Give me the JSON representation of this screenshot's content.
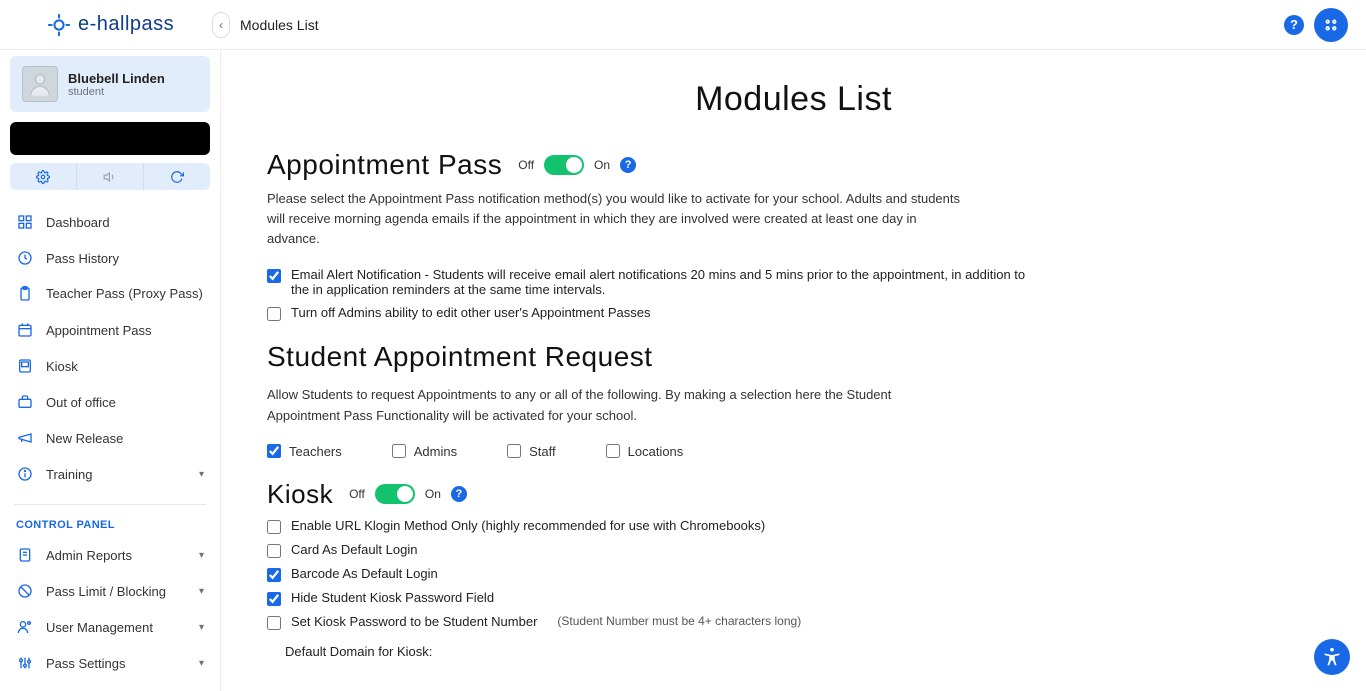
{
  "header": {
    "brand": "e-hallpass",
    "breadcrumb": "Modules List"
  },
  "profile": {
    "name": "Bluebell Linden",
    "role": "student"
  },
  "sidebar": {
    "items": [
      {
        "label": "Dashboard"
      },
      {
        "label": "Pass History"
      },
      {
        "label": "Teacher Pass (Proxy Pass)"
      },
      {
        "label": "Appointment Pass"
      },
      {
        "label": "Kiosk"
      },
      {
        "label": "Out of office"
      },
      {
        "label": "New Release"
      },
      {
        "label": "Training"
      }
    ],
    "section_label": "CONTROL PANEL",
    "panel_items": [
      {
        "label": "Admin Reports"
      },
      {
        "label": "Pass Limit / Blocking"
      },
      {
        "label": "User Management"
      },
      {
        "label": "Pass Settings"
      }
    ]
  },
  "page": {
    "title": "Modules List"
  },
  "appointment": {
    "title": "Appointment Pass",
    "off": "Off",
    "on": "On",
    "desc": "Please select the Appointment Pass notification method(s) you would like to activate for your school. Adults and students will receive morning agenda emails if the appointment in which they are involved were created at least one day in advance.",
    "opt_email": "Email Alert Notification - Students will receive email alert notifications 20 mins and 5 mins prior to the appointment, in addition to the in application reminders at the same time intervals.",
    "opt_admin_off": "Turn off Admins ability to edit other user's Appointment Passes"
  },
  "student_req": {
    "title": "Student Appointment Request",
    "desc": "Allow Students to request Appointments to any or all of the following. By making a selection here the Student Appointment Pass Functionality will be activated for your school.",
    "teachers": "Teachers",
    "admins": "Admins",
    "staff": "Staff",
    "locations": "Locations"
  },
  "kiosk": {
    "title": "Kiosk",
    "off": "Off",
    "on": "On",
    "opt_url": "Enable URL Klogin Method Only (highly recommended for use with Chromebooks)",
    "opt_card": "Card As Default Login",
    "opt_barcode": "Barcode As Default Login",
    "opt_hidepw": "Hide Student Kiosk Password Field",
    "opt_studnum": "Set Kiosk Password to be Student Number",
    "opt_studnum_hint": "(Student Number must be 4+ characters long)",
    "domain_label": "Default Domain for Kiosk:"
  }
}
